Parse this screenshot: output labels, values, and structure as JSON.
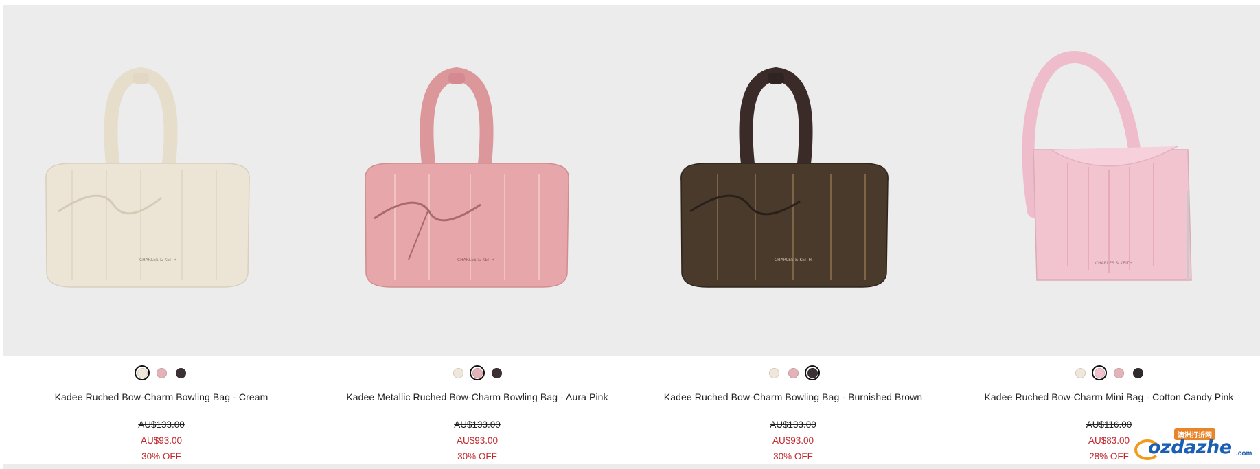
{
  "products": [
    {
      "name": "Kadee Ruched Bow-Charm Bowling Bag - Cream",
      "old_price": "AU$133.00",
      "new_price": "AU$93.00",
      "discount": "30% OFF",
      "swatches": [
        {
          "color": "#efe7da",
          "selected": true
        },
        {
          "color": "#e3b3b8",
          "selected": false
        },
        {
          "color": "#3b3033",
          "selected": false
        }
      ],
      "bag_color": "#ece5d6",
      "handle_color": "#e6ddcb",
      "brand_text": "CHARLES & KEITH"
    },
    {
      "name": "Kadee Metallic Ruched Bow-Charm Bowling Bag - Aura Pink",
      "old_price": "AU$133.00",
      "new_price": "AU$93.00",
      "discount": "30% OFF",
      "swatches": [
        {
          "color": "#efe7da",
          "selected": false
        },
        {
          "color": "#e3b3b8",
          "selected": true
        },
        {
          "color": "#3b3033",
          "selected": false
        }
      ],
      "bag_color": "#e7a7aa",
      "handle_color": "#dc979b",
      "brand_text": "CHARLES & KEITH"
    },
    {
      "name": "Kadee Ruched Bow-Charm Bowling Bag - Burnished Brown",
      "old_price": "AU$133.00",
      "new_price": "AU$93.00",
      "discount": "30% OFF",
      "swatches": [
        {
          "color": "#efe7da",
          "selected": false
        },
        {
          "color": "#e3b3b8",
          "selected": false
        },
        {
          "color": "#3b3033",
          "selected": true
        }
      ],
      "bag_color": "#4a3a2c",
      "handle_color": "#3a2b28",
      "brand_text": "CHARLES & KEITH"
    },
    {
      "name": "Kadee Ruched Bow-Charm Mini Bag - Cotton Candy Pink",
      "old_price": "AU$116.00",
      "new_price": "AU$83.00",
      "discount": "28% OFF",
      "swatches": [
        {
          "color": "#efe7da",
          "selected": false
        },
        {
          "color": "#f0c3cf",
          "selected": true
        },
        {
          "color": "#e3b3b8",
          "selected": false
        },
        {
          "color": "#2f2a2b",
          "selected": false
        }
      ],
      "bag_color": "#f2c4d0",
      "handle_color": "#efbccb",
      "brand_text": "CHARLES & KEITH"
    }
  ],
  "watermark": {
    "badge": "澳洲打折网",
    "text": "ozdazhe",
    "suffix": ".com"
  }
}
